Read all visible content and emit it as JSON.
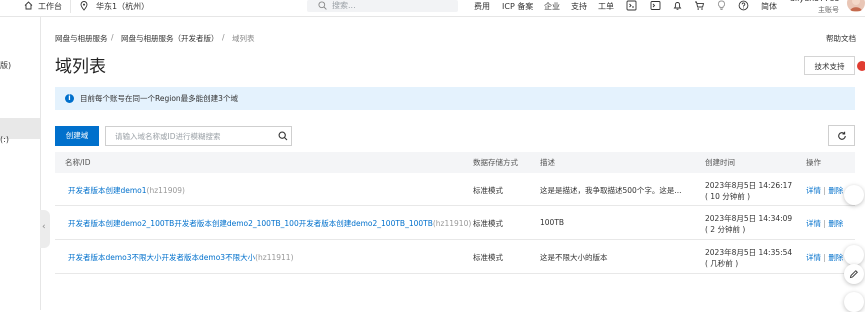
{
  "topbar": {
    "workbench": "工作台",
    "region": "华东1（杭州）",
    "search_placeholder": "搜索...",
    "nav": [
      "费用",
      "ICP 备案",
      "企业",
      "支持",
      "工单"
    ],
    "language": "简体",
    "user_name": "aliyun57785",
    "user_role": "主账号"
  },
  "sidebar": {
    "item1_fragment": "版)",
    "item2_fragment": "(:)"
  },
  "breadcrumb": [
    "网盘与相册服务",
    "网盘与相册服务（开发者版）",
    "域列表"
  ],
  "page": {
    "title": "域列表",
    "help_doc": "帮助文档",
    "tech_support": "技术支持",
    "notice": "目前每个账号在同一个Region最多能创建3个域"
  },
  "toolbar": {
    "create_label": "创建域",
    "search_placeholder": "请输入域名称或ID进行模糊搜索"
  },
  "table": {
    "columns": [
      "名称/ID",
      "数据存储方式",
      "描述",
      "创建时间",
      "操作"
    ],
    "rows": [
      {
        "name": "开发者版本创建demo1",
        "id": "(hz11909)",
        "storage": "标准模式",
        "description": "这是是描述，我争取描述500个字。这是...",
        "created": "2023年8月5日 14:26:17",
        "ago": "( 10 分钟前 )",
        "action_detail": "详情",
        "action_delete": "删除"
      },
      {
        "name": "开发者版本创建demo2_100TB开发者版本创建demo2_100TB_100开发者版本创建demo2_100TB_100TB",
        "id": "(hz11910)",
        "storage": "标准模式",
        "description": "100TB",
        "created": "2023年8月5日 14:34:09",
        "ago": "( 2 分钟前 )",
        "action_detail": "详情",
        "action_delete": "删除"
      },
      {
        "name": "开发者版本demo3不限大小开发者版本demo3不限大小",
        "id": "(hz11911)",
        "storage": "标准模式",
        "description": "这是不限大小的版本",
        "created": "2023年8月5日 14:35:54",
        "ago": "( 几秒前 )",
        "action_detail": "详情",
        "action_delete": "删除"
      }
    ]
  },
  "colors": {
    "primary": "#0070cc",
    "notice_bg": "#e4f2fd",
    "header_bg": "#f4f5f7"
  }
}
